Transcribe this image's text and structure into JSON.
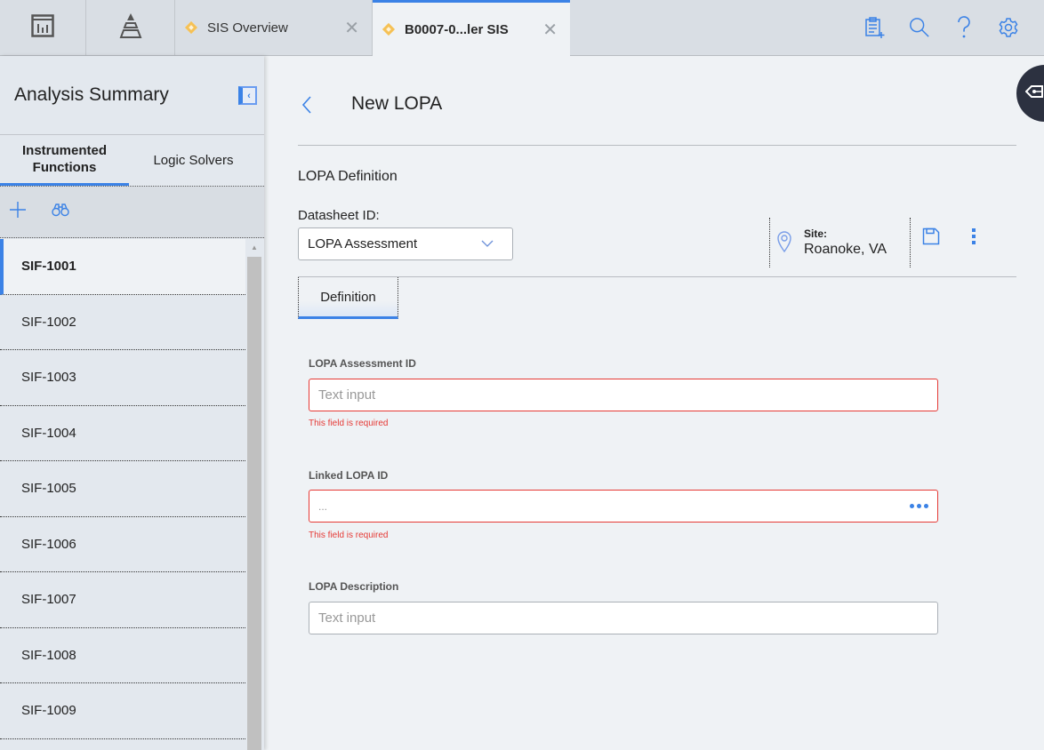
{
  "topbar": {
    "tabs": [
      {
        "label": "SIS Overview",
        "active": false
      },
      {
        "label": "B0007-0...ler SIS",
        "active": true
      }
    ],
    "icons": [
      "dashboard-icon",
      "pyramid-icon",
      "clipboard-add-icon",
      "search-icon",
      "help-icon",
      "gear-icon"
    ]
  },
  "sidebar": {
    "title": "Analysis Summary",
    "tabs": [
      {
        "label": "Instrumented Functions",
        "active": true
      },
      {
        "label": "Logic Solvers",
        "active": false
      }
    ],
    "items": [
      {
        "label": "SIF-1001",
        "active": true
      },
      {
        "label": "SIF-1002"
      },
      {
        "label": "SIF-1003"
      },
      {
        "label": "SIF-1004"
      },
      {
        "label": "SIF-1005"
      },
      {
        "label": "SIF-1006"
      },
      {
        "label": "SIF-1007"
      },
      {
        "label": "SIF-1008"
      },
      {
        "label": "SIF-1009"
      }
    ]
  },
  "main": {
    "title": "New LOPA",
    "section_title": "LOPA Definition",
    "datasheet": {
      "label": "Datasheet ID:",
      "value": "LOPA Assessment"
    },
    "site": {
      "label": "Site:",
      "value": "Roanoke, VA"
    },
    "tabs": [
      {
        "label": "Definition",
        "active": true
      }
    ],
    "fields": [
      {
        "label": "LOPA Assessment ID",
        "placeholder": "Text input",
        "error": "This field is required"
      },
      {
        "label": "Linked LOPA ID",
        "placeholder": "...",
        "error": "This field is required"
      },
      {
        "label": "LOPA Description",
        "placeholder": "Text input"
      }
    ]
  },
  "colors": {
    "accent": "#3b82e6",
    "error": "#e53935",
    "tab_icon": "#f5c156"
  }
}
